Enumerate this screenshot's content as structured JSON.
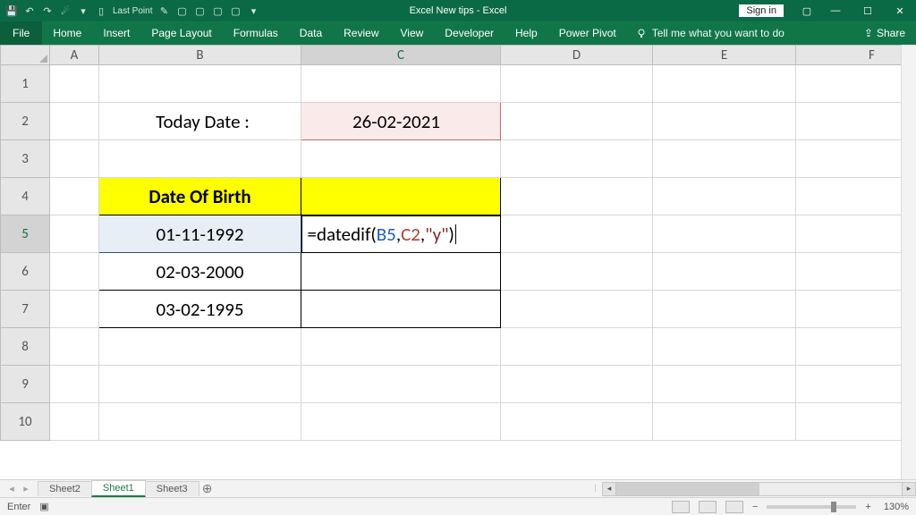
{
  "titlebar": {
    "doc_title": "Excel New tips  -  Excel",
    "sign_in": "Sign in",
    "qat": [
      "save-icon",
      "undo-icon",
      "redo-icon",
      "touch-icon",
      "filter-icon",
      "last-point-icon",
      "edit-icon",
      "more-icon",
      "more-icon",
      "more-icon",
      "more-icon",
      "dropdown-icon"
    ],
    "last_point_label": "Last Point"
  },
  "ribbon": {
    "file": "File",
    "tabs": [
      "Home",
      "Insert",
      "Page Layout",
      "Formulas",
      "Data",
      "Review",
      "View",
      "Developer",
      "Help",
      "Power Pivot"
    ],
    "tell_me": "Tell me what you want to do",
    "share": "Share"
  },
  "columns": [
    "A",
    "B",
    "C",
    "D",
    "E",
    "F"
  ],
  "rows": [
    "1",
    "2",
    "3",
    "4",
    "5",
    "6",
    "7",
    "8",
    "9",
    "10"
  ],
  "active": {
    "col": "C",
    "row": "5"
  },
  "cells": {
    "B2": "Today Date :",
    "C2": "26-02-2021",
    "B4": "Date Of Birth",
    "B5": "01-11-1992",
    "B6": "02-03-2000",
    "B7": "03-02-1995"
  },
  "formula_edit": {
    "prefix": "=datedif(",
    "ref1": "B5",
    "comma1": ",",
    "ref2": "C2",
    "comma2": ",",
    "str": "\"y\"",
    "suffix": ")"
  },
  "sheet_tabs": {
    "items": [
      "Sheet2",
      "Sheet1",
      "Sheet3"
    ],
    "active_index": 1
  },
  "statusbar": {
    "mode": "Enter",
    "zoom": "130%"
  }
}
